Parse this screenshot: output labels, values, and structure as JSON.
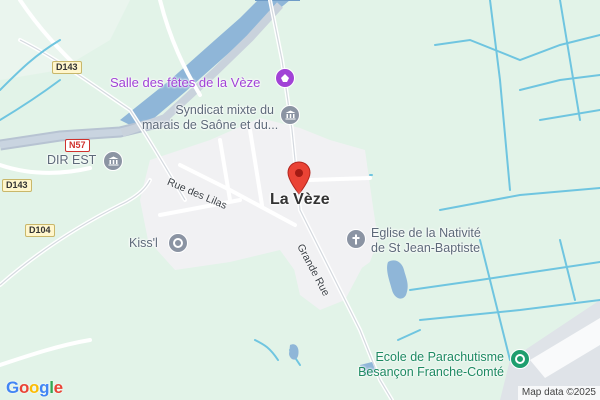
{
  "map": {
    "place_name": "La Vèze",
    "pois": [
      {
        "name": "Salle des fêtes de la Vèze",
        "icon": "event-venue-icon",
        "color": "#a142d6"
      },
      {
        "name_line1": "Syndicat mixte du",
        "name_line2": "marais de Saône et du...",
        "icon": "government-building-icon",
        "color": "#8b94a3"
      },
      {
        "name": "DIR EST",
        "icon": "government-building-icon",
        "color": "#8b94a3"
      },
      {
        "name": "Kiss'l",
        "icon": "pin-icon",
        "color": "#8b94a3"
      },
      {
        "name_line1": "Eglise de la Nativité",
        "name_line2": "de St Jean-Baptiste",
        "icon": "church-cross-icon",
        "color": "#8b94a3"
      },
      {
        "name_line1": "Ecole de Parachutisme",
        "name_line2": "Besançon Franche-Comté",
        "icon": "pin-icon",
        "color": "#1e9e6e"
      }
    ],
    "roads": {
      "d143_a": "D143",
      "d143_b": "D143",
      "d104": "D104",
      "n57": "N57"
    },
    "streets": {
      "rue_des_lilas": "Rue des Lilas",
      "grande_rue": "Grande Rue"
    },
    "marker_color": "#ea4335",
    "logo": "Google",
    "attribution": "Map data ©2025"
  }
}
